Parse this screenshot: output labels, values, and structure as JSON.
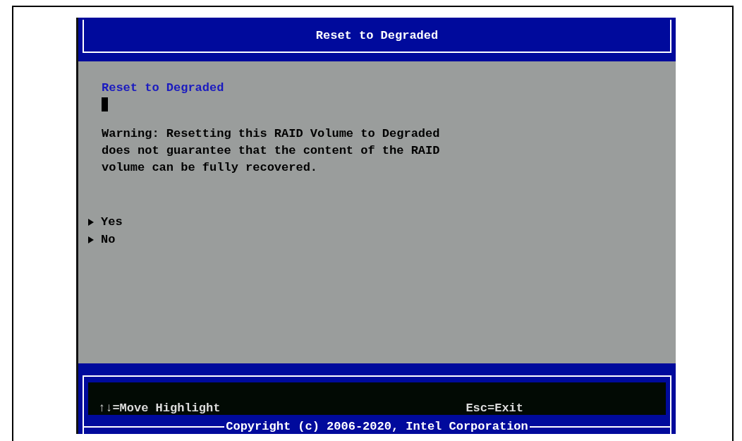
{
  "window": {
    "title": "Reset to Degraded"
  },
  "form": {
    "heading": "Reset to Degraded",
    "warning": "Warning: Resetting this RAID Volume to Degraded\ndoes not guarantee that the content of the RAID\nvolume can be fully recovered.",
    "options": [
      {
        "label": "Yes"
      },
      {
        "label": "No"
      }
    ]
  },
  "footer": {
    "hint_left": "↑↓=Move Highlight",
    "hint_right": "Esc=Exit",
    "copyright": "Copyright (c) 2006-2020, Intel Corporation"
  }
}
